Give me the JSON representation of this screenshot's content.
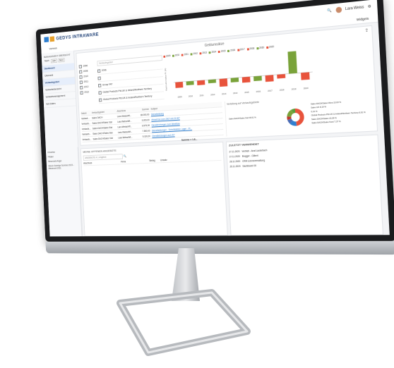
{
  "app": {
    "brand": "GEDYS INTRAWARE",
    "user": "Lara Weiss",
    "tab": "Vertrieb",
    "widgets_label": "Widgets"
  },
  "sidebar": {
    "header": "MANAGEMENT ÜBERSICHT",
    "filter_label": "Nach",
    "filter_opts": [
      "Jahr",
      "Mon"
    ],
    "items": [
      {
        "label": "Dashboard",
        "active": true
      },
      {
        "label": "Übersicht",
        "active": false
      },
      {
        "label": "Verkaufsgebiet",
        "active": true
      },
      {
        "label": "Verkaufsübersicht",
        "active": false
      },
      {
        "label": "Verkaufsmanagement",
        "active": false
      },
      {
        "label": "Vert.Daten",
        "active": false
      }
    ]
  },
  "panel": {
    "title": "Geldumsätze",
    "years": [
      "2006",
      "2008",
      "2010",
      "2011",
      "2012",
      "2013"
    ],
    "search_placeholder": "Verkaufsgebiet",
    "sel_items": [
      "2006",
      "",
      "Group FAT",
      "Global Products Pfd.UK & Ireland/Northern Territory",
      "Global Products Pfd.UK & Ireland/Northern Territory"
    ]
  },
  "chart_data": {
    "type": "bar",
    "categories": [
      "2009",
      "2010",
      "2011",
      "2012",
      "2013",
      "2014",
      "2015",
      "2016",
      "2017",
      "2018",
      "2019",
      "2020"
    ],
    "series": [
      {
        "name": "2009",
        "color": "#e8533c",
        "values": [
          -15,
          0,
          0,
          0,
          0,
          0,
          0,
          0,
          0,
          0,
          0,
          0
        ]
      },
      {
        "name": "2010",
        "color": "#7aa33a",
        "values": [
          0,
          -10,
          0,
          0,
          0,
          0,
          0,
          0,
          0,
          0,
          0,
          0
        ]
      },
      {
        "name": "2011",
        "color": "#e8533c",
        "values": [
          0,
          0,
          -12,
          0,
          0,
          0,
          0,
          0,
          0,
          0,
          0,
          0
        ]
      },
      {
        "name": "2012",
        "color": "#7aa33a",
        "values": [
          0,
          0,
          0,
          -9,
          0,
          0,
          0,
          0,
          0,
          0,
          0,
          0
        ]
      },
      {
        "name": "2013",
        "color": "#e8533c",
        "values": [
          0,
          0,
          0,
          0,
          -20,
          0,
          0,
          0,
          0,
          0,
          0,
          0
        ]
      },
      {
        "name": "2014",
        "color": "#7aa33a",
        "values": [
          0,
          0,
          0,
          0,
          0,
          -11,
          0,
          0,
          0,
          0,
          0,
          0
        ]
      },
      {
        "name": "2015",
        "color": "#e8533c",
        "values": [
          0,
          0,
          0,
          0,
          0,
          0,
          -14,
          0,
          0,
          0,
          0,
          0
        ]
      },
      {
        "name": "2016",
        "color": "#7aa33a",
        "values": [
          0,
          0,
          0,
          0,
          0,
          0,
          0,
          -12,
          0,
          0,
          0,
          0
        ]
      },
      {
        "name": "2017",
        "color": "#e8533c",
        "values": [
          0,
          0,
          0,
          0,
          0,
          0,
          0,
          0,
          -16,
          0,
          0,
          0
        ]
      },
      {
        "name": "2018",
        "color": "#e8533c",
        "values": [
          0,
          0,
          0,
          0,
          0,
          0,
          0,
          0,
          0,
          -10,
          0,
          0
        ]
      },
      {
        "name": "2019",
        "color": "#7aa33a",
        "values": [
          0,
          0,
          0,
          0,
          0,
          0,
          0,
          0,
          0,
          0,
          55,
          0
        ]
      },
      {
        "name": "2020",
        "color": "#e8533c",
        "values": [
          0,
          0,
          0,
          0,
          0,
          0,
          0,
          0,
          0,
          0,
          0,
          -18
        ]
      }
    ],
    "ylabel": "Kauf-Lohn-Faktor Pl. (%)",
    "ylim": [
      -30,
      60
    ]
  },
  "table": {
    "headers": [
      "Datum",
      "Verkaufsgebiet",
      "Abschluss",
      "Summe",
      "Subject"
    ],
    "rows": [
      [
        "Verkauf...",
        "Sales DACH",
        "Lara Weiss/Aff...",
        "38.000,00",
        "Dienstleistung"
      ],
      [
        "Verkaufs...",
        "Sales DACH/Sales Süd",
        "Lara Weiss/Aff...",
        "3.200,00",
        "Aktuell bei zum 2007 mit 20 WT"
      ],
      [
        "Verkaufs...",
        "Sales DACH/Sales Süd",
        "Lara Weiss/Aff...",
        "6.975,00",
        "Dienstleistungen zum Workflow"
      ],
      [
        "Verkaufs...",
        "Sales DACH/Sales Süd",
        "Lara Weiss/Aff...",
        "7.550,00",
        "Dienstleistungen - Schnittstellen Lager - Pr..."
      ],
      [
        "Verkaufs...",
        "Sales DACH/Sales Süd",
        "Lara Weiss/Aff...",
        "9.100,00",
        "Dienstleistungen zum 4/7"
      ]
    ],
    "sum_label": "Summe = 1.8..."
  },
  "donut": {
    "title": "Verteilung auf Verkaufsgebiete",
    "labels": [
      "Sales DACH/Sales West 13,63 %",
      "Sales UK 8,19 %",
      "0,21 %",
      "Global Products Pfd.UK & Ireland/Northern Territory 6,61 %",
      "Sales DACH/Sales 15,39 %",
      "Sales DACH/Sales Nord 7,37 %",
      "Sales DACH/Sales Süd 48,61 %"
    ]
  },
  "lower": {
    "left_lines": [
      "Hinweise",
      "Filialen",
      "Steuerzeit-Angel",
      "Steuer-Anzeige Sommer 2021 - Steuerzeit 2021"
    ],
    "mid_title": "MEINE OFFENEN ANGEBOTE",
    "mid_search": "ANGEBOTE 4.1 Angebot",
    "mid_cols": [
      "Abschluss",
      "Firma",
      "Betrag",
      "Umsatz"
    ],
    "right_title": "ZULETZT VERWENDET",
    "recent": [
      {
        "date": "27.11.2020",
        "text": "Vertrieb - Anal Lauterbach"
      },
      {
        "date": "27.11.2020",
        "text": "Brugger - Gilbert"
      },
      {
        "date": "26.11.2020",
        "text": "CRM Lizenzverwaltung"
      },
      {
        "date": "25.11.2020",
        "text": "Dashboard 00"
      }
    ]
  }
}
